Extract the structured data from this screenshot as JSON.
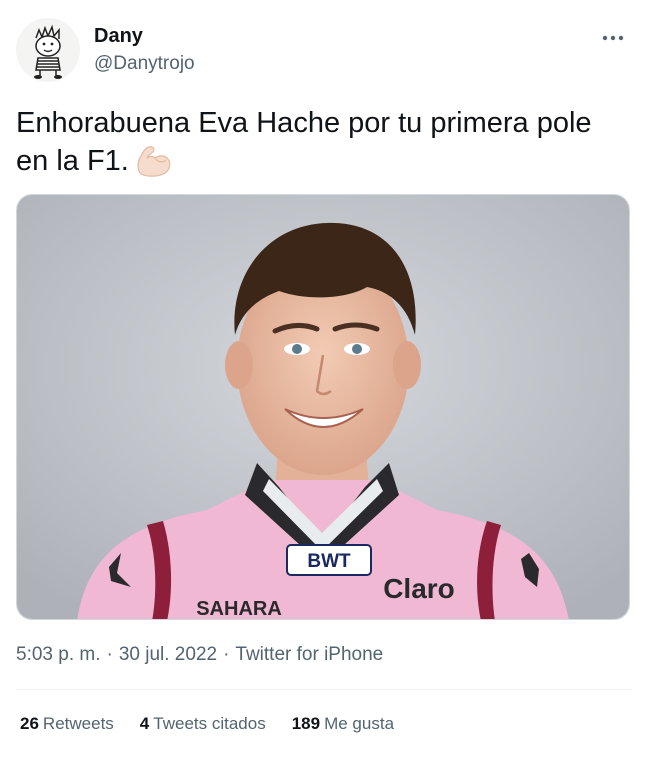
{
  "author": {
    "display_name": "Dany",
    "handle": "@Danytrojo",
    "avatar_icon": "cartoon-boy-avatar"
  },
  "menu": {
    "more_icon": "more-horizontal-icon"
  },
  "tweet": {
    "text_line1": "Enhorabuena Eva Hache por tu primera pole",
    "text_line2": "en la F1.",
    "emoji_icon": "flexed-biceps-emoji",
    "media_badges": {
      "badge_1": "BWT",
      "badge_2": "Claro",
      "badge_3": "SAHARA"
    }
  },
  "meta": {
    "time": "5:03 p. m.",
    "separator": "·",
    "date": "30 jul. 2022",
    "source": "Twitter for iPhone"
  },
  "stats": {
    "retweets_count": "26",
    "retweets_label": "Retweets",
    "quotes_count": "4",
    "quotes_label": "Tweets citados",
    "likes_count": "189",
    "likes_label": "Me gusta"
  },
  "colors": {
    "text_primary": "#0f1419",
    "text_secondary": "#536471",
    "divider": "#eff3f4",
    "suit_pink": "#f0b8d2",
    "suit_dark": "#2a2a2e"
  }
}
